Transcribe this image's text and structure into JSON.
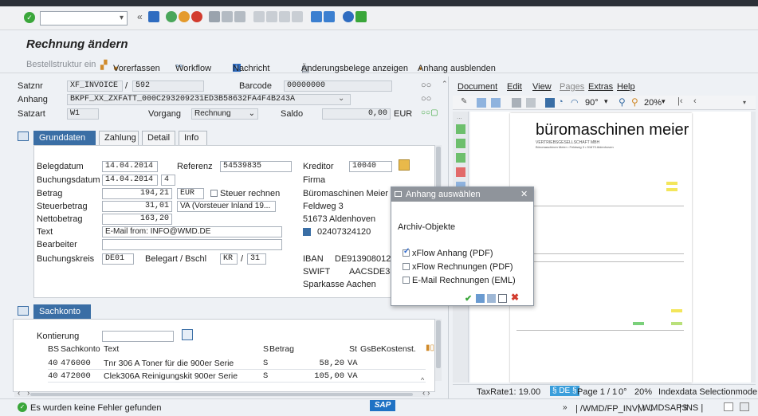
{
  "app": {
    "title": "Rechnung ändern"
  },
  "toolbar": {
    "command_value": ""
  },
  "app_toolbar": {
    "bestellstruktur": "Bestellstruktur ein",
    "vorerfassen": "Vorerfassen",
    "workflow": "Workflow",
    "nachricht": "Nachricht",
    "aenderungsbelege": "Änderungsbelege anzeigen",
    "anhang_ausblenden": "Anhang ausblenden"
  },
  "header": {
    "satznr_label": "Satznr",
    "satznr_value": "XF_INVOICE",
    "satznr_sep": "/",
    "satznr_num": "592",
    "barcode_label": "Barcode",
    "barcode_value": "00000000",
    "anhang_label": "Anhang",
    "anhang_value": "BKPF_XX_ZXFATT_000C293209231ED3B58632FA4F4B243A",
    "satzart_label": "Satzart",
    "satzart_value": "W1",
    "vorgang_label": "Vorgang",
    "vorgang_value": "Rechnung",
    "saldo_label": "Saldo",
    "saldo_value": "0,00",
    "saldo_currency": "EUR"
  },
  "tabs": [
    "Grunddaten",
    "Zahlung",
    "Detail",
    "Info"
  ],
  "grunddaten": {
    "belegdatum_label": "Belegdatum",
    "belegdatum": "14.04.2014",
    "referenz_label": "Referenz",
    "referenz": "54539835",
    "buchungsdatum_label": "Buchungsdatum",
    "buchungsdatum": "14.04.2014",
    "periode": "4",
    "betrag_label": "Betrag",
    "betrag": "194,21",
    "waehrung": "EUR",
    "steuer_rechnen": "Steuer rechnen",
    "steuerbetrag_label": "Steuerbetrag",
    "steuerbetrag": "31,01",
    "steuerkennz": "VA (Vorsteuer Inland 19...",
    "nettobetrag_label": "Nettobetrag",
    "nettobetrag": "163,20",
    "text_label": "Text",
    "text": "E-Mail from: INFO@WMD.DE",
    "bearbeiter_label": "Bearbeiter",
    "bearbeiter": "",
    "buchungskreis_label": "Buchungskreis",
    "buchungskreis": "DE01",
    "belegart_label": "Belegart / Bschl",
    "belegart": "KR",
    "bschl_sep": "/",
    "bschl": "31"
  },
  "kreditor": {
    "label": "Kreditor",
    "nummer": "10040",
    "anrede": "Firma",
    "name": "Büromaschinen Meier",
    "strasse": "Feldweg 3",
    "ort": "51673 Aldenhoven",
    "telefon": "02407324120",
    "iban_label": "IBAN",
    "iban": "DE91390801260",
    "swift_label": "SWIFT",
    "swift": "AACSDE33",
    "bank": "Sparkasse Aachen"
  },
  "sachkonto": {
    "tab": "Sachkonto",
    "kontierung_label": "Kontierung",
    "kontierung_value": "",
    "columns": [
      "BS",
      "Sachkonto",
      "Text",
      "S",
      "Betrag",
      "St",
      "GsBe",
      "Kostenst."
    ],
    "rows": [
      {
        "bs": "40",
        "konto": "476000",
        "text": "Tnr 306 A Toner für die 900er Serie",
        "s": "S",
        "betrag": "58,20",
        "st": "VA"
      },
      {
        "bs": "40",
        "konto": "472000",
        "text": "Clek306A Reinigungskit 900er Serie",
        "s": "S",
        "betrag": "105,00",
        "st": "VA"
      }
    ]
  },
  "viewer": {
    "menu": [
      "Document",
      "Edit",
      "View",
      "Pages",
      "Extras",
      "Help"
    ],
    "rotation": "90°",
    "zoom": "20%",
    "doc_title": "büromaschinen meier",
    "doc_sub": "VERTRIEBSGESELLSCHAFT MBH",
    "doc_addr": "Büromaschinen Meier • Feldweg 3 • 51673 Aldenhoven",
    "status_taxrate": "TaxRate1: 19.00",
    "status_tag": "§ DE §",
    "status_page": "Page 1 / 1",
    "status_rot": "0°",
    "status_zoom": "20%",
    "status_mode": "Indexdata Selectionmode"
  },
  "dialog": {
    "title": "Anhang auswählen",
    "section": "Archiv-Objekte",
    "options": [
      {
        "label": "xFlow Anhang (PDF)",
        "checked": true
      },
      {
        "label": "xFlow Rechnungen (PDF)",
        "checked": false
      },
      {
        "label": "E-Mail Rechnungen (EML)",
        "checked": false
      }
    ]
  },
  "status": {
    "message": "Es wurden keine Fehler gefunden",
    "brand": "SAP",
    "transaction": "/WMD/FP_INVM",
    "system": "WMDSAPS",
    "mode": "INS"
  },
  "colors": {
    "accent": "#3a6ea5",
    "success": "#3aa63a",
    "sap_blue": "#1f72c4"
  }
}
